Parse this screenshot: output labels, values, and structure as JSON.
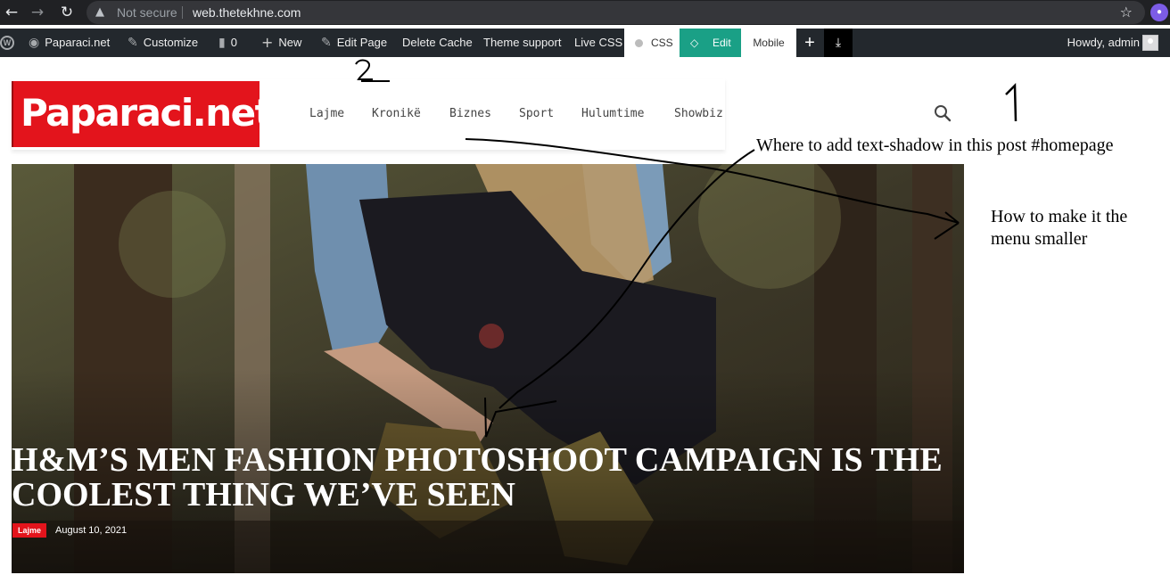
{
  "browser": {
    "back_icon": "arrow-left-icon",
    "forward_icon": "arrow-right-icon",
    "reload_icon": "reload-icon",
    "security_label": "Not secure",
    "url": "web.thetekhne.com"
  },
  "admin_bar": {
    "site_name": "Paparaci.net",
    "customize": "Customize",
    "comments_count": "0",
    "new": "New",
    "edit_page": "Edit Page",
    "delete_cache": "Delete Cache",
    "theme_support": "Theme support",
    "live_css": "Live CSS",
    "css_tab": "CSS",
    "edit_tab": "Edit",
    "mobile_tab": "Mobile",
    "add_icon": "plus-icon",
    "download_icon": "download-icon",
    "howdy": "Howdy, admin"
  },
  "site": {
    "logo_text": "Paparaci.net",
    "menu": [
      "Lajme",
      "Kronikë",
      "Biznes",
      "Sport",
      "Hulumtime",
      "Showbiz"
    ],
    "search_icon": "search-icon"
  },
  "hero": {
    "title": "H&M’S MEN FASHION PHOTOSHOOT CAMPAIGN IS THE COOLEST THING WE’VE SEEN",
    "category": "Lajme",
    "date": "August 10, 2021"
  },
  "annotations": {
    "mark_two": "2",
    "mark_one": "1",
    "note_text_shadow": "Where to add text-shadow in this post #homepage",
    "note_menu_line1": "How to make it the",
    "note_menu_line2": "menu smaller"
  },
  "colors": {
    "brand_red": "#e3141c",
    "admin_bar": "#23282d",
    "edit_green": "#1aa086"
  }
}
